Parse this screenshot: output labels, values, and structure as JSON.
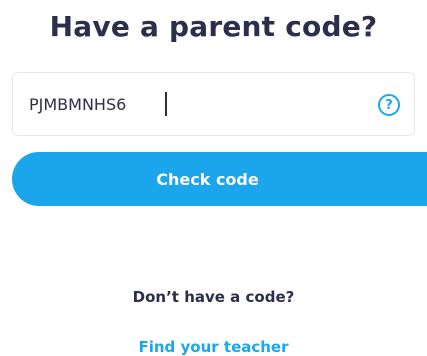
{
  "heading": "Have a parent code?",
  "code_input": {
    "value": "PJMBMNHS6",
    "help_icon": "question-circle-icon",
    "help_glyph": "?"
  },
  "check_button": {
    "label": "Check code"
  },
  "no_code": {
    "text": "Don’t have a code?",
    "link_label": "Find your teacher"
  },
  "colors": {
    "accent": "#1ba6ec",
    "text_dark": "#2c2f4a",
    "border": "#e6e8ee",
    "background": "#ffffff"
  }
}
